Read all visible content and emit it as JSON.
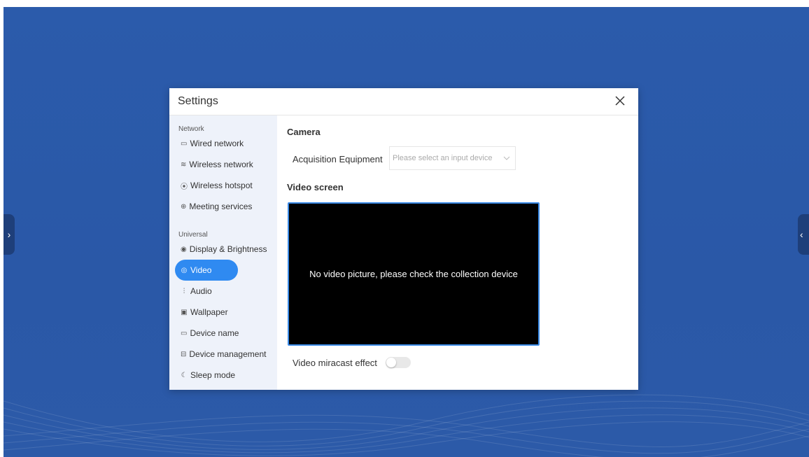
{
  "dialog": {
    "title": "Settings"
  },
  "sidebar": {
    "groups": [
      {
        "label": "Network",
        "items": [
          {
            "icon": "monitor-icon",
            "glyph": "▭",
            "label": "Wired network"
          },
          {
            "icon": "wifi-icon",
            "glyph": "≋",
            "label": "Wireless network"
          },
          {
            "icon": "hotspot-icon",
            "glyph": "⦿",
            "label": "Wireless hotspot"
          },
          {
            "icon": "globe-icon",
            "glyph": "⊕",
            "label": "Meeting services"
          }
        ]
      },
      {
        "label": "Universal",
        "items": [
          {
            "icon": "eye-icon",
            "glyph": "◉",
            "label": "Display & Brightness"
          },
          {
            "icon": "camera-icon",
            "glyph": "◎",
            "label": "Video"
          },
          {
            "icon": "audio-icon",
            "glyph": "⫶",
            "label": "Audio"
          },
          {
            "icon": "wallpaper-icon",
            "glyph": "▣",
            "label": "Wallpaper"
          },
          {
            "icon": "device-icon",
            "glyph": "▭",
            "label": "Device name"
          },
          {
            "icon": "device-management-icon",
            "glyph": "⊟",
            "label": "Device management"
          },
          {
            "icon": "sleep-icon",
            "glyph": "☾",
            "label": "Sleep mode"
          }
        ]
      }
    ],
    "active": "Video"
  },
  "content": {
    "camera_title": "Camera",
    "acquisition_label": "Acquisition Equipment",
    "acquisition_placeholder": "Please select an input device",
    "video_screen_title": "Video screen",
    "video_message": "No video picture, please check the collection device",
    "miracast_label": "Video miracast effect",
    "miracast_enabled": false
  },
  "colors": {
    "desktop_bg": "#2b5bab",
    "accent": "#2f8af1",
    "sidebar_bg": "#eef2fa"
  }
}
